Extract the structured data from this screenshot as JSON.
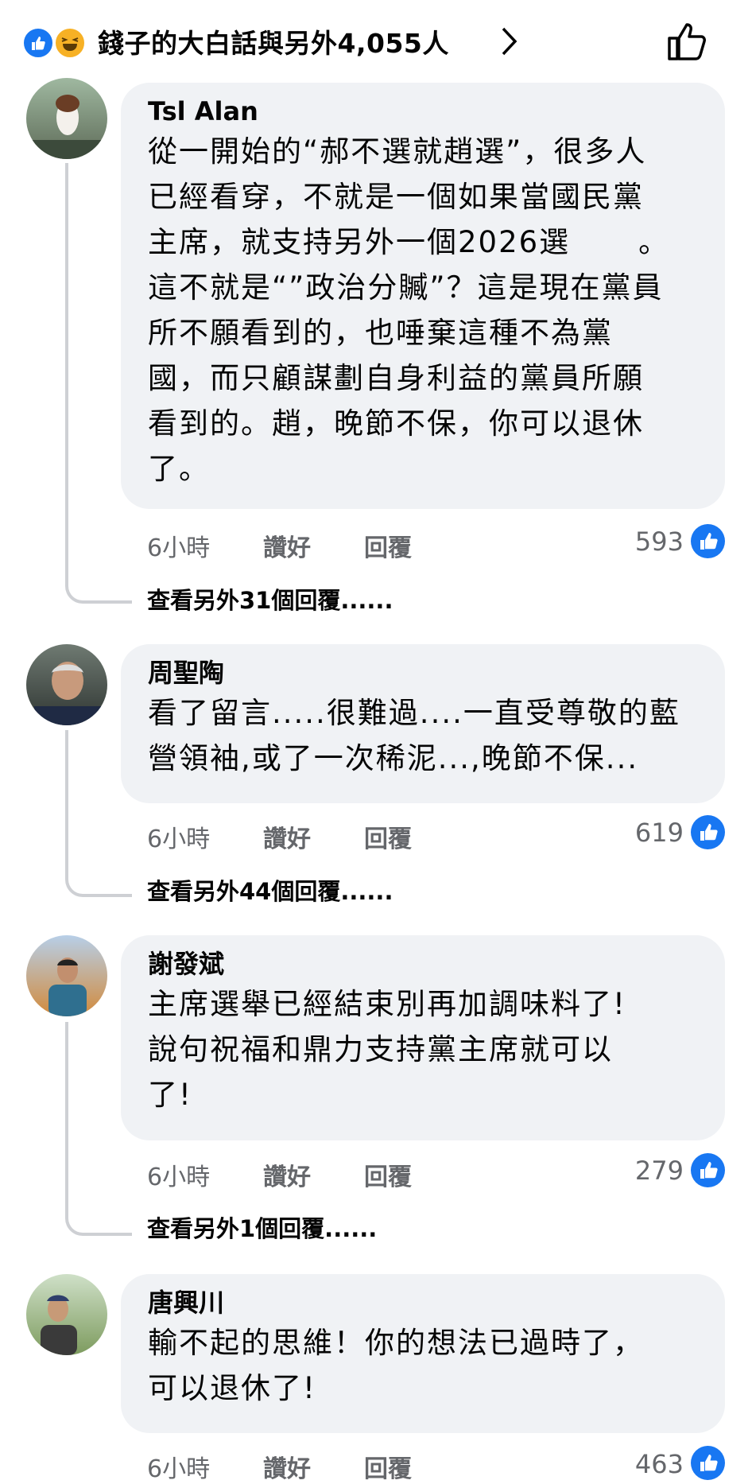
{
  "header": {
    "reactors": "錢子的大白話與另外4,055人"
  },
  "comments": [
    {
      "author": "Tsl Alan",
      "text": "從一開始的“郝不選就趙選”，很多人\n已經看穿，不就是一個如果當國民黨\n主席，就支持另外一個2026選",
      "text_tail": "。\n這不就是“”政治分贓”？這是現在黨員\n所不願看到的，也唾棄這種不為黨\n國，而只顧謀劃自身利益的黨員所願\n看到的。趙，晚節不保，你可以退休\n了。",
      "time": "6小時",
      "like": "讚好",
      "reply": "回覆",
      "count": "593",
      "more": "查看另外31個回覆......"
    },
    {
      "author": "周聖陶",
      "text": "看了留言.....很難過....一直受尊敬的藍\n營領袖,或了一次稀泥...,晚節不保...",
      "time": "6小時",
      "like": "讚好",
      "reply": "回覆",
      "count": "619",
      "more": "查看另外44個回覆......"
    },
    {
      "author": "謝發斌",
      "text": "主席選舉已經結束別再加調味料了!\n說句祝福和鼎力支持黨主席就可以\n了!",
      "time": "6小時",
      "like": "讚好",
      "reply": "回覆",
      "count": "279",
      "more": "查看另外1個回覆......"
    },
    {
      "author": "唐興川",
      "text": "輸不起的思維！你的想法已過時了，\n可以退休了!",
      "time": "6小時",
      "like": "讚好",
      "reply": "回覆",
      "count": "463"
    }
  ],
  "colors": {
    "accent": "#1877f2",
    "bubble": "#f0f2f5",
    "meta": "#65676b"
  }
}
